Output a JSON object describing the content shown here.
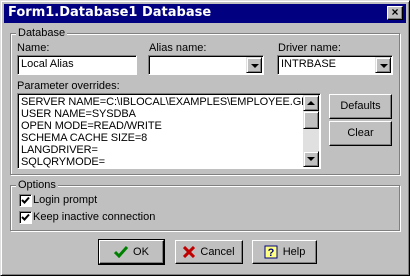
{
  "window": {
    "title": "Form1.Database1 Database",
    "close_label": "×"
  },
  "database_group": {
    "label": "Database",
    "name_label": "Name:",
    "name_value": "Local Alias",
    "alias_label": "Alias name:",
    "alias_value": "",
    "driver_label": "Driver name:",
    "driver_value": "INTRBASE"
  },
  "parameters": {
    "label": "Parameter overrides:",
    "lines": [
      "SERVER NAME=C:\\IBLOCAL\\EXAMPLES\\EMPLOYEE.GD",
      "USER NAME=SYSDBA",
      "OPEN MODE=READ/WRITE",
      "SCHEMA CACHE SIZE=8",
      "LANGDRIVER=",
      "SQLQRYMODE="
    ],
    "defaults_button": "Defaults",
    "clear_button": "Clear"
  },
  "options_group": {
    "label": "Options",
    "login_prompt": {
      "label": "Login prompt",
      "checked": true
    },
    "keep_connection": {
      "label": "Keep inactive connection",
      "checked": true
    }
  },
  "buttons": {
    "ok": "OK",
    "cancel": "Cancel",
    "help": "Help"
  },
  "colors": {
    "titlebar": "#000080",
    "face": "#c0c0c0",
    "ok_check": "#008000",
    "cancel_x": "#c00000"
  }
}
